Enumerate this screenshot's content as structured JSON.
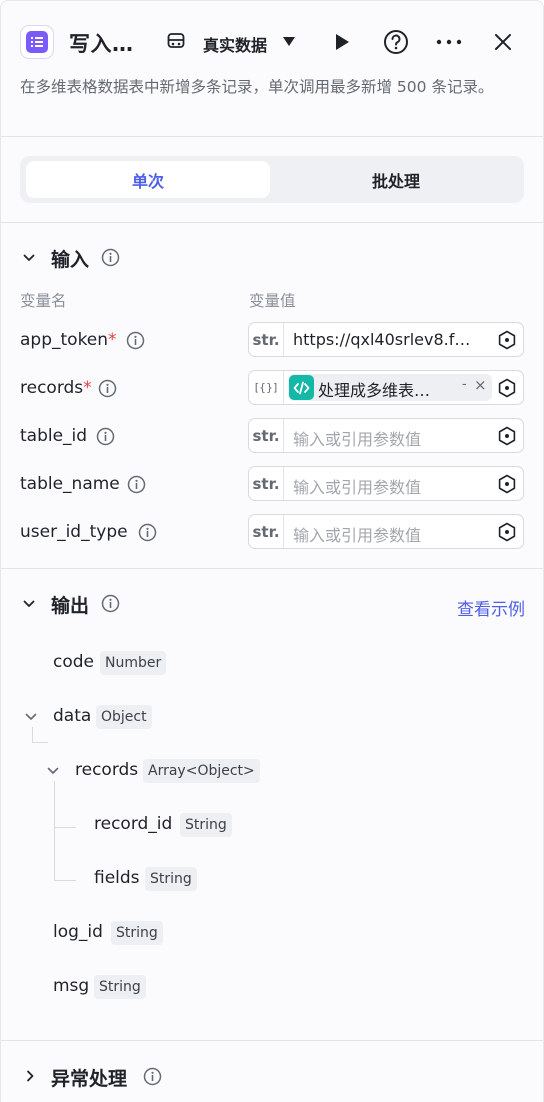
{
  "header": {
    "title": "写入…",
    "mode_label": "真实数据",
    "description": "在多维表格数据表中新增多条记录，单次调用最多新增 500 条记录。"
  },
  "tabs": [
    {
      "label": "单次",
      "active": true
    },
    {
      "label": "批处理",
      "active": false
    }
  ],
  "input": {
    "section_title": "输入",
    "col_name": "变量名",
    "col_value": "变量值",
    "params": [
      {
        "name": "app_token",
        "required": true,
        "type": "str.",
        "value": "https://qxl40srlev8.f…",
        "placeholder": ""
      },
      {
        "name": "records",
        "required": true,
        "type": "[{}]",
        "value": "处理成多维表…",
        "placeholder": ""
      },
      {
        "name": "table_id",
        "required": false,
        "type": "str.",
        "value": "",
        "placeholder": "输入或引用参数值"
      },
      {
        "name": "table_name",
        "required": false,
        "type": "str.",
        "value": "",
        "placeholder": "输入或引用参数值"
      },
      {
        "name": "user_id_type",
        "required": false,
        "type": "str.",
        "value": "",
        "placeholder": "输入或引用参数值"
      }
    ],
    "required_mark": "*",
    "tag_dash": "-",
    "tag_close": "×"
  },
  "output": {
    "section_title": "输出",
    "view_example": "查看示例",
    "fields": [
      {
        "name": "code",
        "type": "Number"
      },
      {
        "name": "data",
        "type": "Object"
      },
      {
        "name": "records",
        "type": "Array<Object>"
      },
      {
        "name": "record_id",
        "type": "String"
      },
      {
        "name": "fields",
        "type": "String"
      },
      {
        "name": "log_id",
        "type": "String"
      },
      {
        "name": "msg",
        "type": "String"
      }
    ]
  },
  "exception": {
    "section_title": "异常处理"
  },
  "colors": {
    "accent": "#4e5fe6",
    "app_icon": "#7a5af8",
    "code_tag": "#14b8a6",
    "required": "#e53e3e"
  }
}
